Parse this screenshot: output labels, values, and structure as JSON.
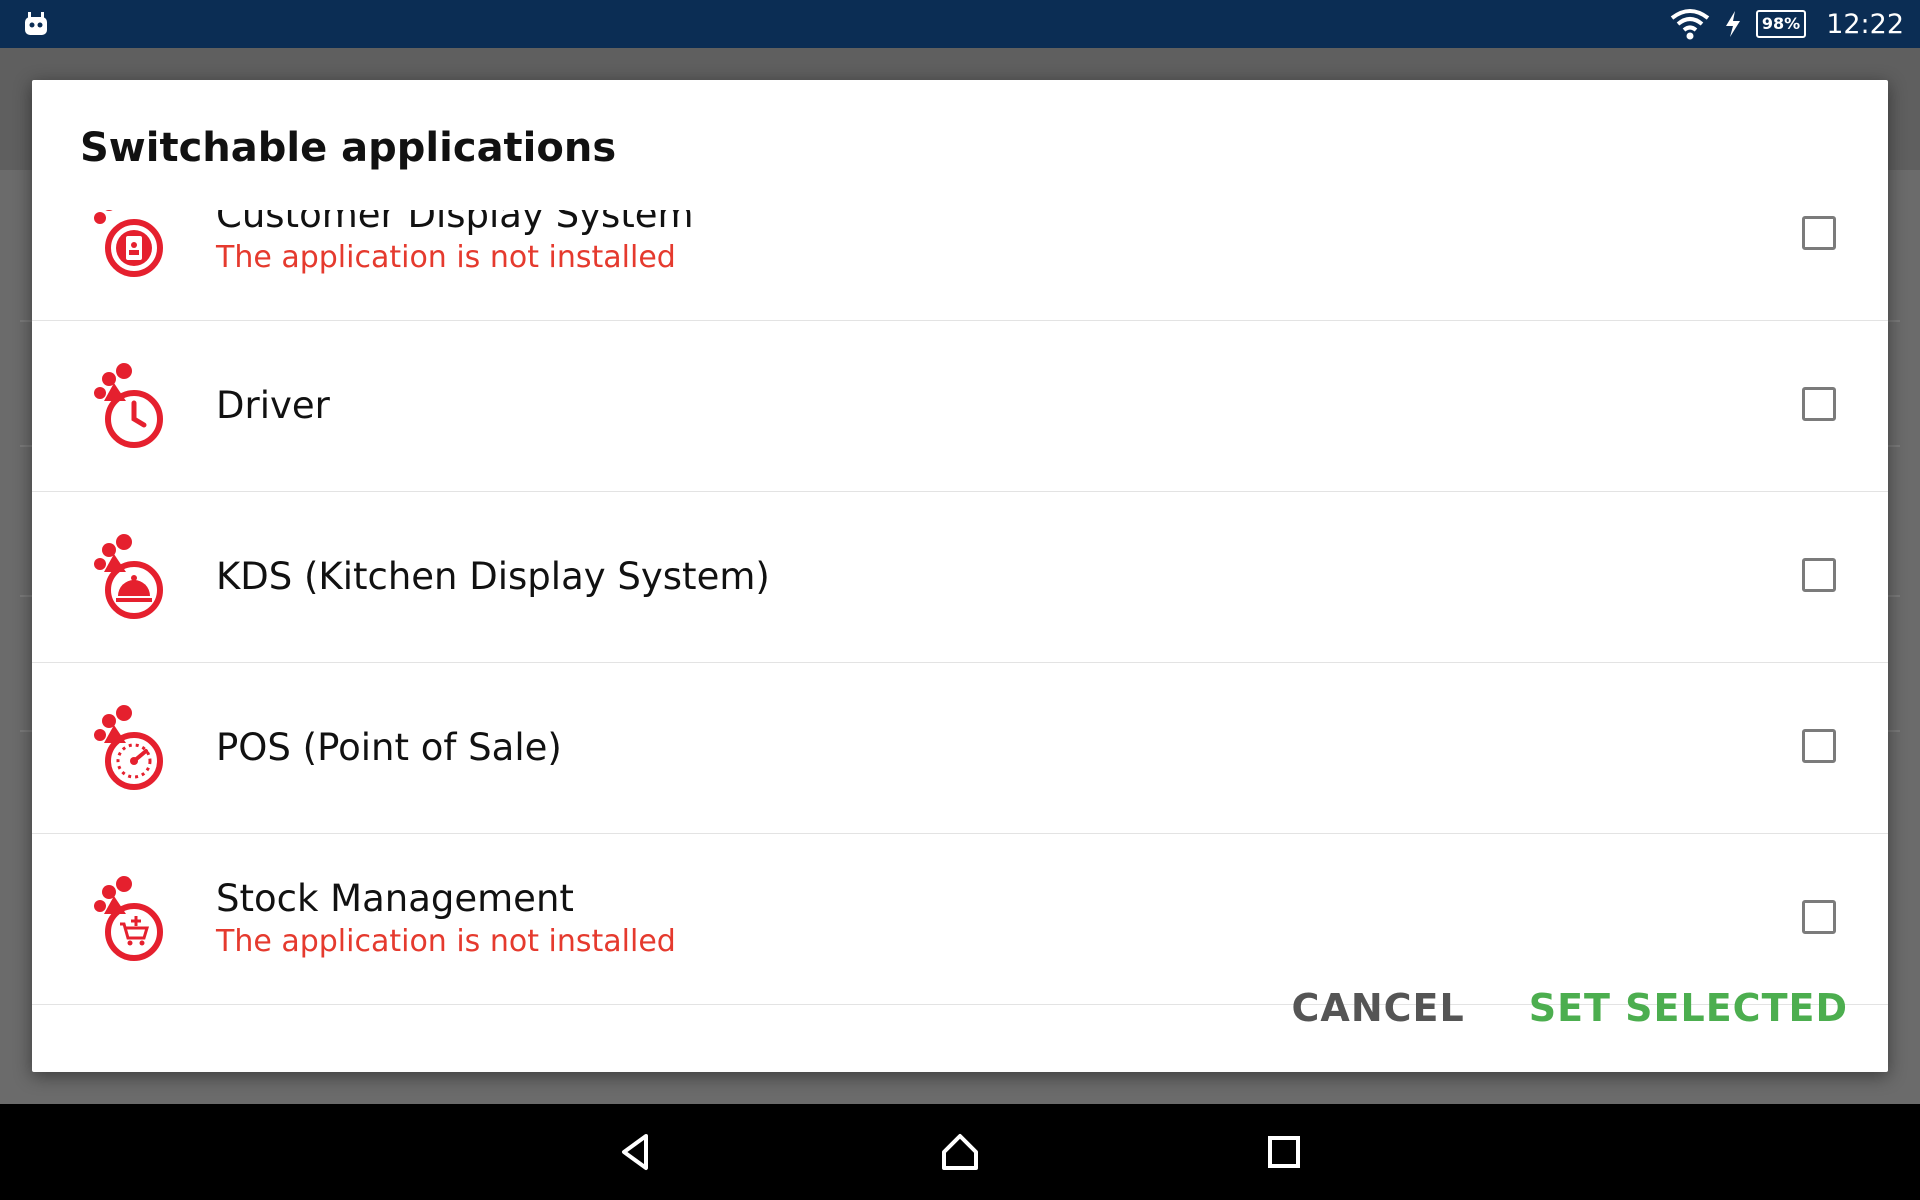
{
  "status_bar": {
    "battery_percent": "98%",
    "time": "12:22",
    "icons": [
      "android-bot-icon",
      "wifi-icon",
      "charging-icon",
      "battery-icon"
    ]
  },
  "dialog": {
    "title": "Switchable applications",
    "items": [
      {
        "name": "Customer Display System",
        "status": "The application is not installed",
        "checked": false,
        "icon": "customer-display-icon"
      },
      {
        "name": "Driver",
        "status": "",
        "checked": false,
        "icon": "driver-clock-icon"
      },
      {
        "name": "KDS (Kitchen Display System)",
        "status": "",
        "checked": false,
        "icon": "kitchen-cloche-icon"
      },
      {
        "name": "POS (Point of Sale)",
        "status": "",
        "checked": false,
        "icon": "pos-gauge-icon"
      },
      {
        "name": "Stock Management",
        "status": "The application is not installed",
        "checked": false,
        "icon": "stock-cart-icon"
      }
    ],
    "cancel_label": "CANCEL",
    "set_selected_label": "SET SELECTED"
  },
  "colors": {
    "status_bar": "#0b2d54",
    "brand_red": "#e5202e",
    "error_text": "#e53a2e",
    "accent_green": "#4cae4f"
  },
  "nav_bar": {
    "buttons": [
      "back-icon",
      "home-icon",
      "recents-icon"
    ]
  }
}
